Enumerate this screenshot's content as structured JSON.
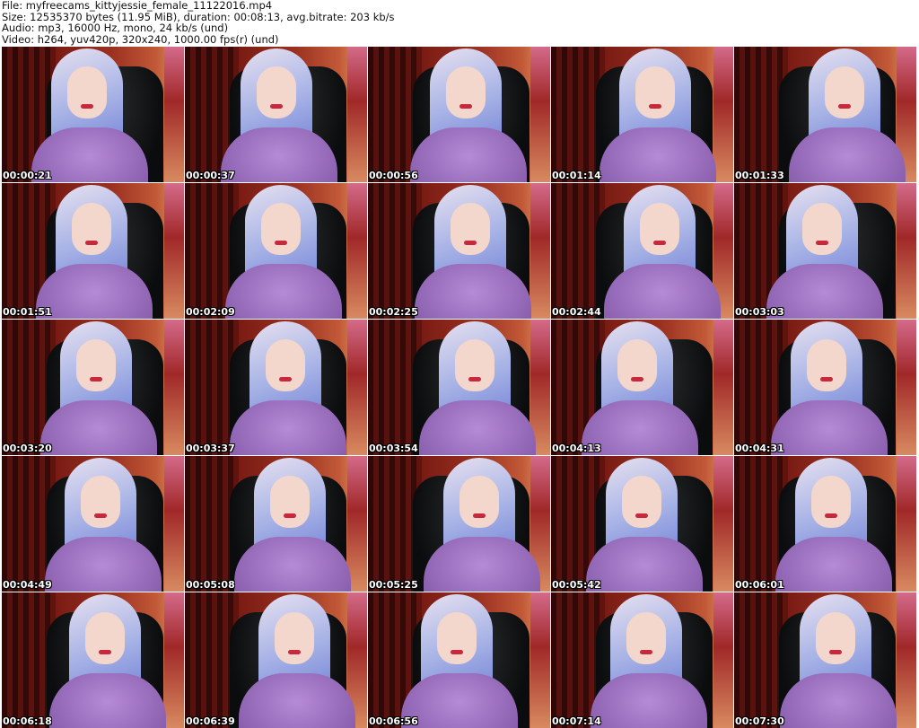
{
  "header": {
    "file": "File: myfreecams_kittyjessie_female_11122016.mp4",
    "size": "Size: 12535370 bytes (11.95 MiB), duration: 00:08:13, avg.bitrate: 203 kb/s",
    "audio": "Audio: mp3, 16000 Hz, mono, 24 kb/s (und)",
    "video": "Video: h264, yuv420p, 320x240, 1000.00 fps(r) (und)"
  },
  "timestamps": [
    "00:00:21",
    "00:00:37",
    "00:00:56",
    "00:01:14",
    "00:01:33",
    "00:01:51",
    "00:02:09",
    "00:02:25",
    "00:02:44",
    "00:03:03",
    "00:03:20",
    "00:03:37",
    "00:03:54",
    "00:04:13",
    "00:04:31",
    "00:04:49",
    "00:05:08",
    "00:05:25",
    "00:05:42",
    "00:06:01",
    "00:06:18",
    "00:06:39",
    "00:06:56",
    "00:07:14",
    "00:07:30"
  ]
}
